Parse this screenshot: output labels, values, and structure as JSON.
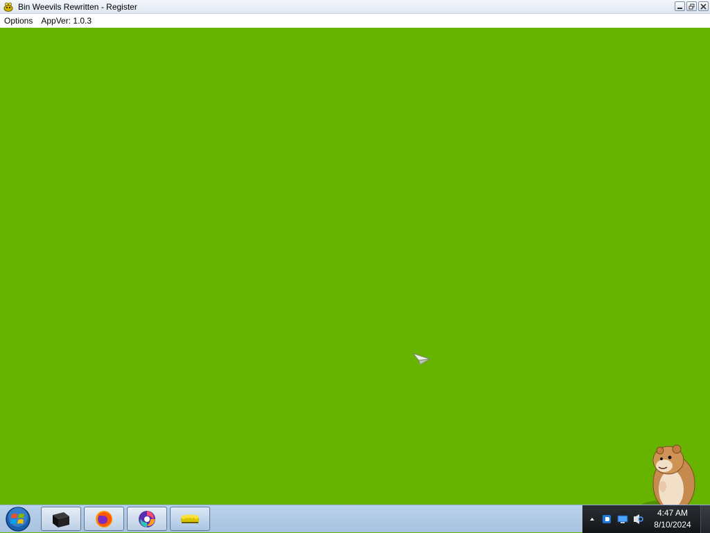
{
  "window": {
    "title": "Bin Weevils Rewritten - Register",
    "app_icon": "weevil-icon",
    "controls": [
      "minimize",
      "restore",
      "close"
    ]
  },
  "menu": {
    "items": [
      {
        "label": "Options"
      },
      {
        "label": "AppVer: 1.0.3"
      }
    ]
  },
  "game": {
    "background_color": "#66b300",
    "elements": {
      "cursor": "paper-plane-cursor",
      "mascot": "hamster-mascot"
    }
  },
  "taskbar": {
    "start": "start-orb",
    "buttons": [
      {
        "name": "black-app-icon"
      },
      {
        "name": "firefox-icon"
      },
      {
        "name": "colorful-swirl-app-icon"
      },
      {
        "name": "bin-weevils-icon"
      }
    ],
    "tray": {
      "icons": [
        "show-hidden-icons-arrow",
        "app-tray-icon",
        "network-icon",
        "volume-icon"
      ],
      "clock_time": "4:47 AM",
      "clock_date": "8/10/2024"
    }
  }
}
